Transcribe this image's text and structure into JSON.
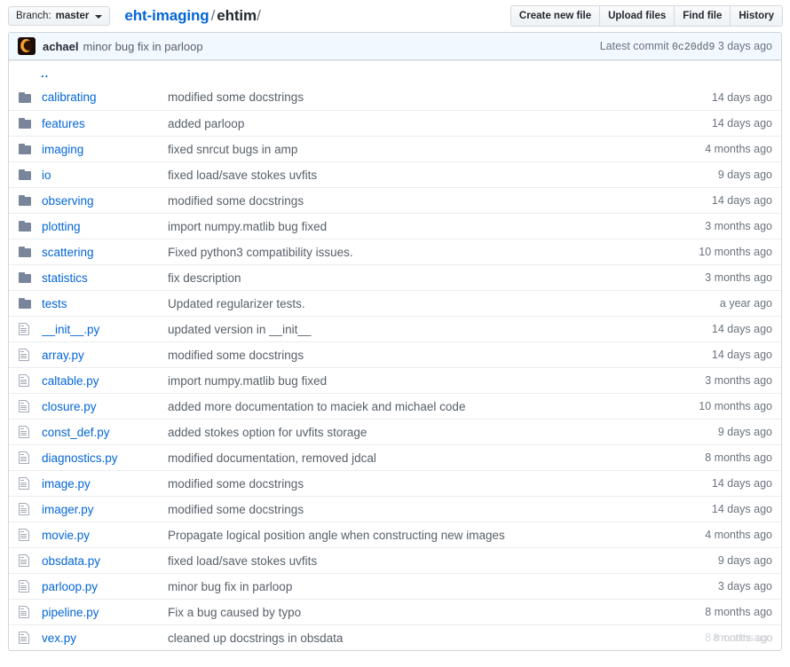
{
  "toolbar": {
    "branch": {
      "label": "Branch:",
      "name": "master"
    },
    "breadcrumb": {
      "repo": "eht-imaging",
      "separator": "/",
      "current": "ehtim",
      "trailing": "/"
    },
    "buttons": [
      "Create new file",
      "Upload files",
      "Find file",
      "History"
    ]
  },
  "commit_bar": {
    "author": "achael",
    "message": "minor bug fix in parloop",
    "latest_label": "Latest commit",
    "sha": "0c20dd9",
    "age": "3 days ago"
  },
  "parent_dir": "..",
  "rows": [
    {
      "type": "dir",
      "name": "calibrating",
      "message": "modified some docstrings",
      "age": "14 days ago"
    },
    {
      "type": "dir",
      "name": "features",
      "message": "added parloop",
      "age": "14 days ago"
    },
    {
      "type": "dir",
      "name": "imaging",
      "message": "fixed snrcut bugs in amp",
      "age": "4 months ago"
    },
    {
      "type": "dir",
      "name": "io",
      "message": "fixed load/save stokes uvfits",
      "age": "9 days ago"
    },
    {
      "type": "dir",
      "name": "observing",
      "message": "modified some docstrings",
      "age": "14 days ago"
    },
    {
      "type": "dir",
      "name": "plotting",
      "message": "import numpy.matlib bug fixed",
      "age": "3 months ago"
    },
    {
      "type": "dir",
      "name": "scattering",
      "message": "Fixed python3 compatibility issues.",
      "age": "10 months ago"
    },
    {
      "type": "dir",
      "name": "statistics",
      "message": "fix description",
      "age": "3 months ago"
    },
    {
      "type": "dir",
      "name": "tests",
      "message": "Updated regularizer tests.",
      "age": "a year ago"
    },
    {
      "type": "file",
      "name": "__init__.py",
      "message": "updated version in __init__",
      "age": "14 days ago"
    },
    {
      "type": "file",
      "name": "array.py",
      "message": "modified some docstrings",
      "age": "14 days ago"
    },
    {
      "type": "file",
      "name": "caltable.py",
      "message": "import numpy.matlib bug fixed",
      "age": "3 months ago"
    },
    {
      "type": "file",
      "name": "closure.py",
      "message": "added more documentation to maciek and michael code",
      "age": "10 months ago"
    },
    {
      "type": "file",
      "name": "const_def.py",
      "message": "added stokes option for uvfits storage",
      "age": "9 days ago"
    },
    {
      "type": "file",
      "name": "diagnostics.py",
      "message": "modified documentation, removed jdcal",
      "age": "8 months ago"
    },
    {
      "type": "file",
      "name": "image.py",
      "message": "modified some docstrings",
      "age": "14 days ago"
    },
    {
      "type": "file",
      "name": "imager.py",
      "message": "modified some docstrings",
      "age": "14 days ago"
    },
    {
      "type": "file",
      "name": "movie.py",
      "message": "Propagate logical position angle when constructing new images",
      "age": "4 months ago"
    },
    {
      "type": "file",
      "name": "obsdata.py",
      "message": "fixed load/save stokes uvfits",
      "age": "9 days ago"
    },
    {
      "type": "file",
      "name": "parloop.py",
      "message": "minor bug fix in parloop",
      "age": "3 days ago"
    },
    {
      "type": "file",
      "name": "pipeline.py",
      "message": "Fix a bug caused by typo",
      "age": "8 months ago"
    },
    {
      "type": "file",
      "name": "vex.py",
      "message": "cleaned up docstrings in obsdata",
      "age": "8 months ago",
      "age_obscured": true,
      "watermark": "8 months ago"
    }
  ],
  "colors": {
    "link": "#0366d6",
    "muted": "#586069",
    "border": "#d1d5da",
    "row_border": "#eaecef",
    "commit_bar_bg": "#f1f8ff",
    "button_bg": "#eff3f6"
  }
}
